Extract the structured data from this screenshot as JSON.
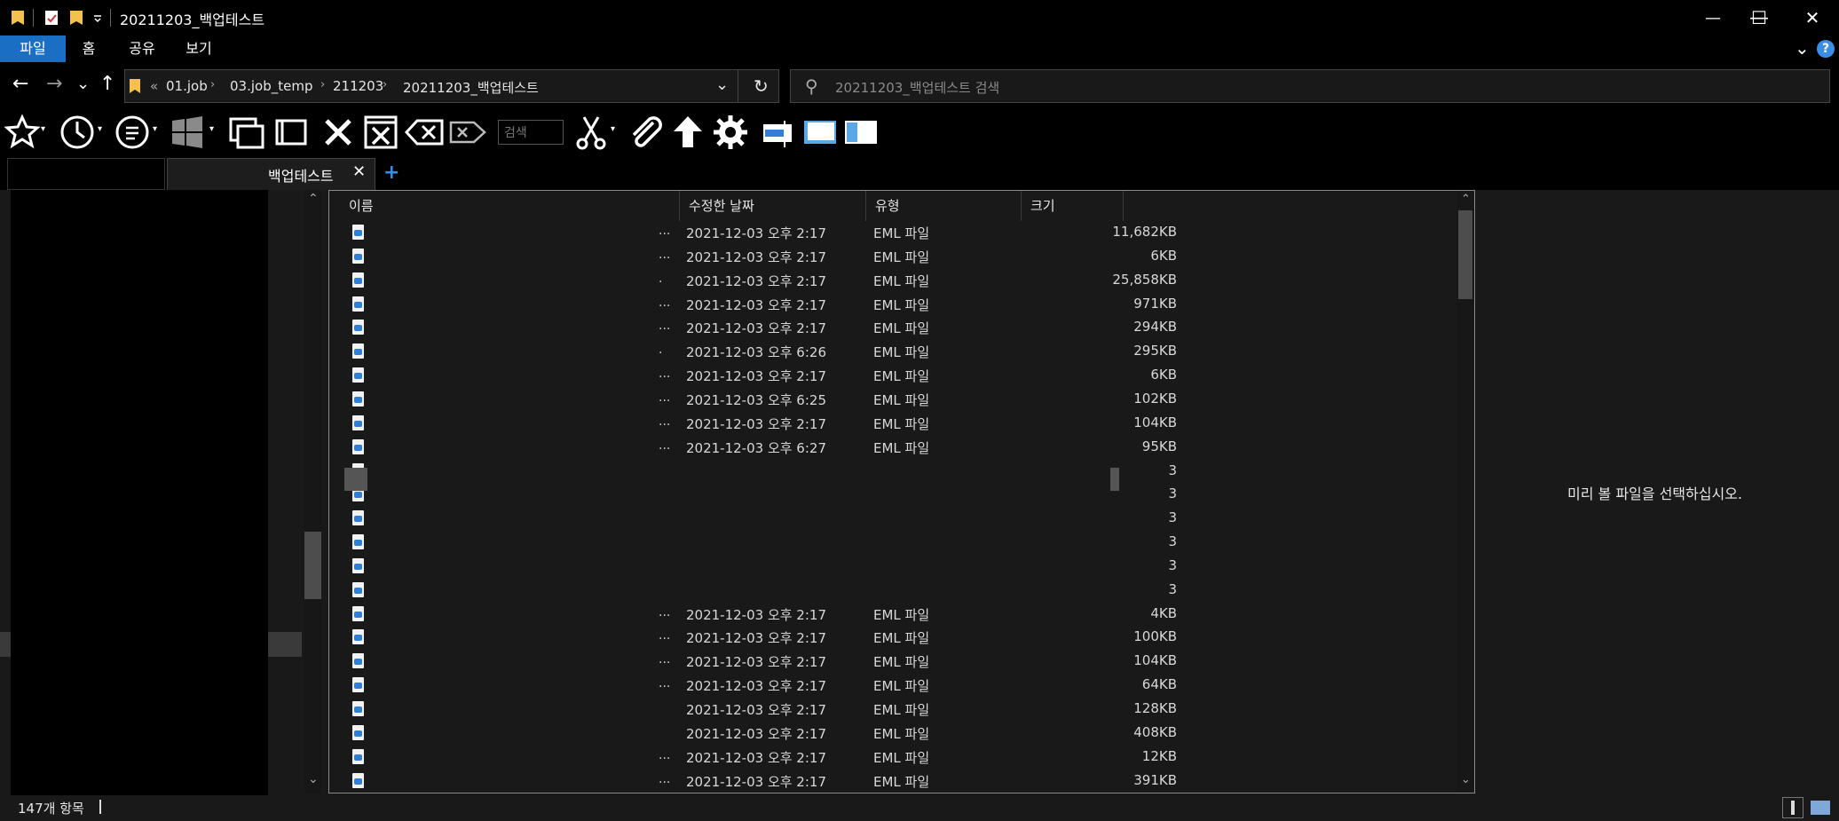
{
  "titlebar": {
    "title": "20211203_백업테스트",
    "minimize_glyph": "—",
    "maximize_glyph": "☐",
    "close_glyph": "✕"
  },
  "ribbon": {
    "tabs": [
      "파일",
      "홈",
      "공유",
      "보기"
    ],
    "expand_glyph": "⌄",
    "help_glyph": "?"
  },
  "address": {
    "back_glyph": "←",
    "forward_glyph": "→",
    "recent_glyph": "⌄",
    "up_glyph": "↑",
    "overflow": "«",
    "crumbs": [
      "01.job",
      "03.job_temp",
      "211203",
      "20211203_백업테스트"
    ],
    "sep": "›",
    "dropdown_glyph": "⌄",
    "refresh_glyph": "↻"
  },
  "search": {
    "placeholder": "20211203_백업테스트 검색",
    "icon_glyph": "⚲"
  },
  "toolbar": {
    "search_placeholder": "검색"
  },
  "tabs": {
    "active_label": "백업테스트",
    "close_glyph": "✕",
    "add_glyph": "+"
  },
  "filelist": {
    "columns": [
      "이름",
      "수정한 날짜",
      "유형",
      "크기"
    ],
    "sort_glyph": "⌃",
    "rows": [
      {
        "dots": "...",
        "date": "2021-12-03 오후 2:17",
        "type": "EML 파일",
        "size": "11,682KB"
      },
      {
        "dots": "...",
        "date": "2021-12-03 오후 2:17",
        "type": "EML 파일",
        "size": "6KB"
      },
      {
        "dots": ".",
        "date": "2021-12-03 오후 2:17",
        "type": "EML 파일",
        "size": "25,858KB"
      },
      {
        "dots": "...",
        "date": "2021-12-03 오후 2:17",
        "type": "EML 파일",
        "size": "971KB"
      },
      {
        "dots": "...",
        "date": "2021-12-03 오후 2:17",
        "type": "EML 파일",
        "size": "294KB"
      },
      {
        "dots": ".",
        "date": "2021-12-03 오후 6:26",
        "type": "EML 파일",
        "size": "295KB"
      },
      {
        "dots": "...",
        "date": "2021-12-03 오후 2:17",
        "type": "EML 파일",
        "size": "6KB"
      },
      {
        "dots": "...",
        "date": "2021-12-03 오후 6:25",
        "type": "EML 파일",
        "size": "102KB"
      },
      {
        "dots": "...",
        "date": "2021-12-03 오후 2:17",
        "type": "EML 파일",
        "size": "104KB"
      },
      {
        "dots": "...",
        "date": "2021-12-03 오후 6:27",
        "type": "EML 파일",
        "size": "95KB"
      },
      {
        "dots": "",
        "date": "",
        "type": "",
        "size": "3"
      },
      {
        "dots": "",
        "date": "",
        "type": "",
        "size": "3"
      },
      {
        "dots": "",
        "date": "",
        "type": "",
        "size": "3"
      },
      {
        "dots": "",
        "date": "",
        "type": "",
        "size": "3"
      },
      {
        "dots": "",
        "date": "",
        "type": "",
        "size": "3"
      },
      {
        "dots": "",
        "date": "",
        "type": "",
        "size": "3"
      },
      {
        "dots": "...",
        "date": "2021-12-03 오후 2:17",
        "type": "EML 파일",
        "size": "4KB"
      },
      {
        "dots": "...",
        "date": "2021-12-03 오후 2:17",
        "type": "EML 파일",
        "size": "100KB"
      },
      {
        "dots": "...",
        "date": "2021-12-03 오후 2:17",
        "type": "EML 파일",
        "size": "104KB"
      },
      {
        "dots": "...",
        "date": "2021-12-03 오후 2:17",
        "type": "EML 파일",
        "size": "64KB"
      },
      {
        "dots": "",
        "date": "2021-12-03 오후 2:17",
        "type": "EML 파일",
        "size": "128KB"
      },
      {
        "dots": "",
        "date": "2021-12-03 오후 2:17",
        "type": "EML 파일",
        "size": "408KB"
      },
      {
        "dots": "...",
        "date": "2021-12-03 오후 2:17",
        "type": "EML 파일",
        "size": "12KB"
      },
      {
        "dots": "...",
        "date": "2021-12-03 오후 2:17",
        "type": "EML 파일",
        "size": "391KB"
      }
    ]
  },
  "preview": {
    "message": "미리 볼 파일을 선택하십시오."
  },
  "status": {
    "count": "147개 항목"
  },
  "colors": {
    "accent": "#1a6fc4",
    "help": "#3b8ee8",
    "folder": "#f4c04e",
    "eml_blue": "#2f7fd6"
  }
}
